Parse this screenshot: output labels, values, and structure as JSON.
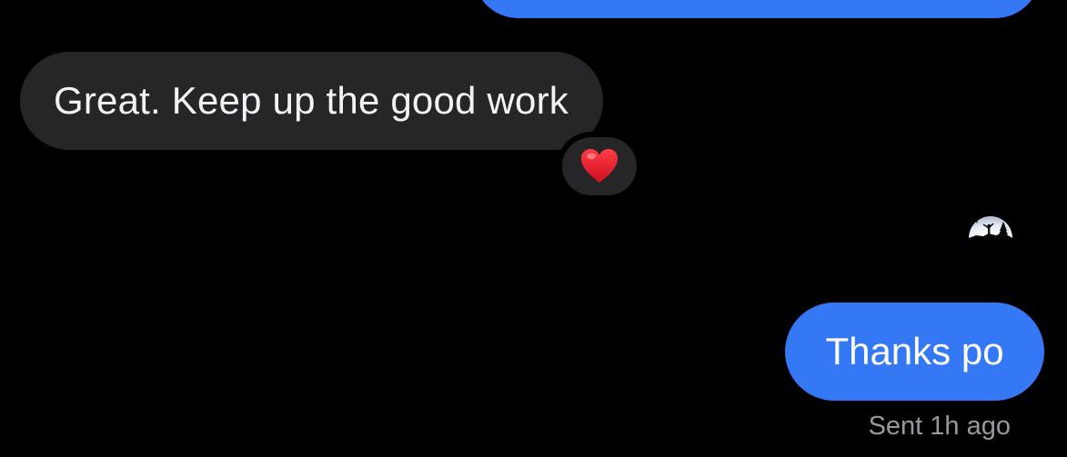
{
  "thread": {
    "messages": [
      {
        "direction": "outgoing",
        "text": ""
      },
      {
        "direction": "incoming",
        "text": "Great. Keep up the good work",
        "reaction": "heart"
      },
      {
        "direction": "outgoing",
        "text": "Thanks po"
      }
    ],
    "received_message": {
      "text": "Great. Keep up the good work",
      "reaction_icon": "heart-icon"
    },
    "sent_message": {
      "text": "Thanks po"
    },
    "seen_avatar_icon": "avatar-icon",
    "status": "Sent 1h ago"
  },
  "colors": {
    "background": "#000000",
    "sent_bubble": "#3478F6",
    "received_bubble": "#262628",
    "received_text": "#F2F2F7",
    "sent_text": "#FFFFFF",
    "status_text": "#98989F",
    "heart": "#E0202E"
  }
}
